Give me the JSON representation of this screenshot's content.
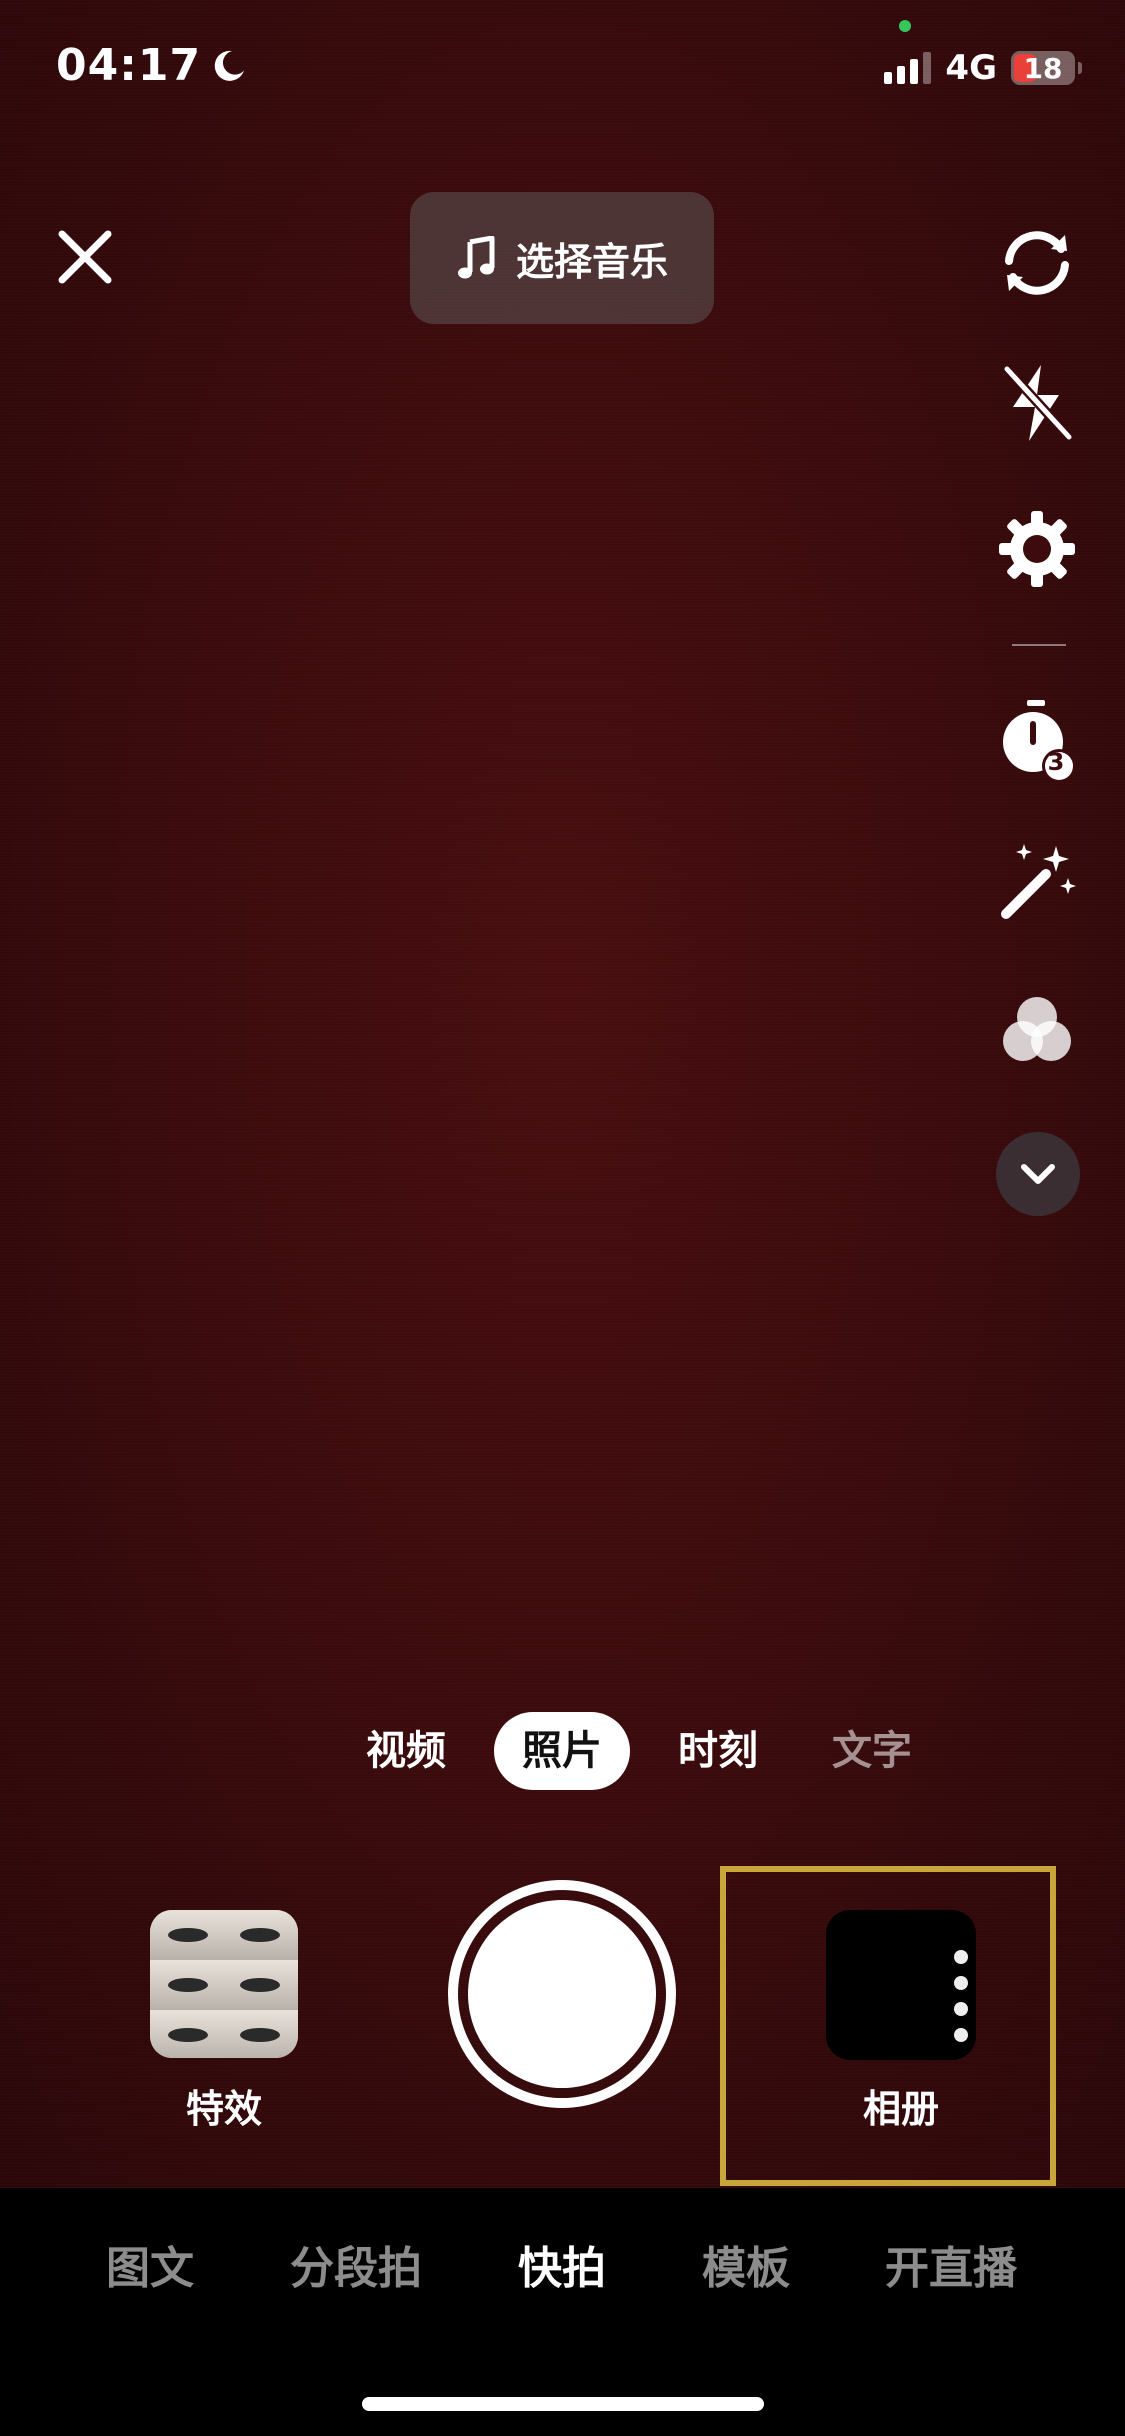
{
  "status_bar": {
    "time": "04:17",
    "network": "4G",
    "battery": "18"
  },
  "top": {
    "music_label": "选择音乐"
  },
  "right_tools": [
    {
      "name": "flip-camera-icon"
    },
    {
      "name": "flash-off-icon"
    },
    {
      "name": "settings-gear-icon"
    },
    {
      "name": "timer-icon",
      "badge": "3"
    },
    {
      "name": "beauty-wand-icon"
    },
    {
      "name": "filter-icon"
    },
    {
      "name": "chevron-down-icon"
    }
  ],
  "modes": {
    "items": [
      "视频",
      "照片",
      "时刻",
      "文字"
    ],
    "selected": "照片"
  },
  "capture_row": {
    "effects_label": "特效",
    "album_label": "相册"
  },
  "tab_bar": {
    "items": [
      "图文",
      "分段拍",
      "快拍",
      "模板",
      "开直播"
    ],
    "selected": "快拍"
  },
  "colors": {
    "viewfinder": "#3d0b0d",
    "album_highlight": "#c9a63a",
    "battery_low": "#e9403a"
  }
}
